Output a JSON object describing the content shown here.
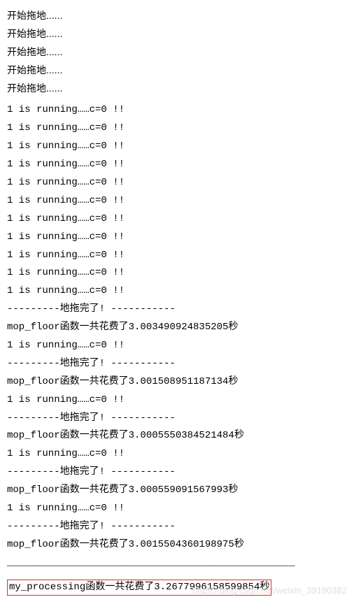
{
  "start_lines": [
    "开始拖地......",
    "开始拖地......",
    "开始拖地......",
    "开始拖地......",
    "开始拖地......"
  ],
  "running_lines_block1": [
    "1 is running……c=0 !!",
    "1 is running……c=0 !!",
    "1 is running……c=0 !!",
    "1 is running……c=0 !!",
    "1 is running……c=0 !!",
    "1 is running……c=0 !!",
    "1 is running……c=0 !!",
    "1 is running……c=0 !!",
    "1 is running……c=0 !!",
    "1 is running……c=0 !!",
    "1 is running……c=0 !!"
  ],
  "repeat_blocks": [
    {
      "done": "---------地拖完了! -----------",
      "summary": "mop_floor函数一共花费了3.003490924835205秒",
      "running": "1 is running……c=0 !!"
    },
    {
      "done": "---------地拖完了! -----------",
      "summary": "mop_floor函数一共花费了3.001508951187134秒",
      "running": "1 is running……c=0 !!"
    },
    {
      "done": "---------地拖完了! -----------",
      "summary": "mop_floor函数一共花费了3.0005550384521484秒",
      "running": "1 is running……c=0 !!"
    },
    {
      "done": "---------地拖完了! -----------",
      "summary": "mop_floor函数一共花费了3.000559091567993秒",
      "running": "1 is running……c=0 !!"
    },
    {
      "done": "---------地拖完了! -----------",
      "summary": "mop_floor函数一共花费了3.0015504360198975秒",
      "running": null
    }
  ],
  "separator": "_________________________________________________",
  "final_summary": "my_processing函数一共花费了3.2677996158599854秒",
  "watermark": "https://blog.csdn.net/weixin_39190382"
}
